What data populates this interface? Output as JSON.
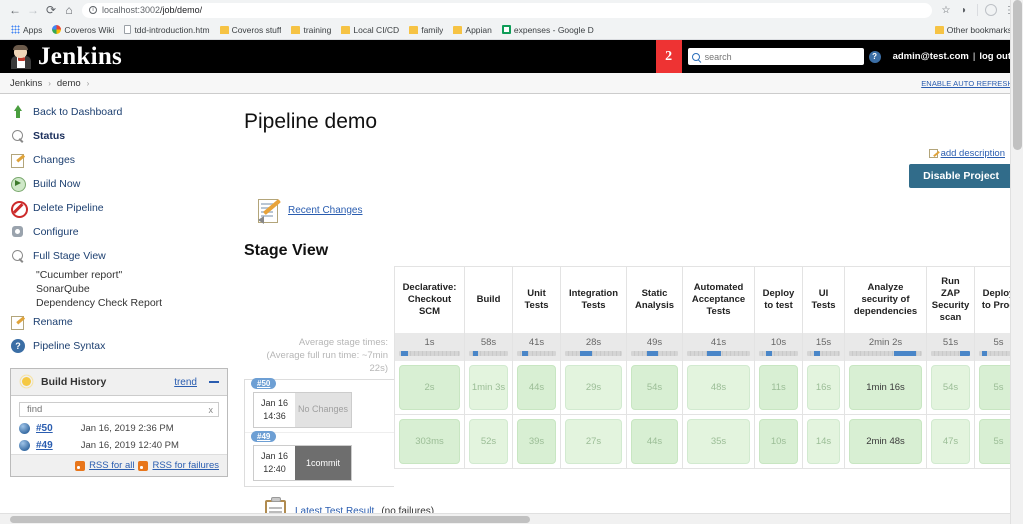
{
  "browser": {
    "nav": {
      "back": "←",
      "forward": "→",
      "reload": "⟳",
      "home": "⌂"
    },
    "url_host": "localhost:3002",
    "url_path": "/job/demo/",
    "star_icon": "☆",
    "moon_icon": "◗",
    "menu_icon": "⋮",
    "bookmarks": [
      {
        "label": "Apps",
        "icon": "apps-icon"
      },
      {
        "label": "Coveros Wiki",
        "icon": "google-icon"
      },
      {
        "label": "tdd-introduction.htm",
        "icon": "document-icon"
      },
      {
        "label": "Coveros stuff",
        "icon": "folder-icon"
      },
      {
        "label": "training",
        "icon": "folder-icon"
      },
      {
        "label": "Local CI/CD",
        "icon": "folder-icon"
      },
      {
        "label": "family",
        "icon": "folder-icon"
      },
      {
        "label": "Appian",
        "icon": "folder-icon"
      },
      {
        "label": "expenses - Google D",
        "icon": "sheets-icon"
      }
    ],
    "other_bookmarks": "Other bookmarks"
  },
  "header": {
    "title": "Jenkins",
    "queue_count": "2",
    "search_placeholder": "search",
    "help_icon": "?",
    "user": "admin@test.com",
    "separator": "|",
    "logout": "log out"
  },
  "breadcrumb": {
    "items": [
      "Jenkins",
      "demo"
    ],
    "arrow": "›",
    "auto_refresh": "ENABLE AUTO REFRESH"
  },
  "sidebar": {
    "items": [
      {
        "label": "Back to Dashboard",
        "icon": "up-arrow-icon",
        "bold": false
      },
      {
        "label": "Status",
        "icon": "magnifier-icon",
        "bold": true
      },
      {
        "label": "Changes",
        "icon": "edit-icon",
        "bold": false
      },
      {
        "label": "Build Now",
        "icon": "play-icon",
        "bold": false
      },
      {
        "label": "Delete Pipeline",
        "icon": "deny-icon",
        "bold": false
      },
      {
        "label": "Configure",
        "icon": "gear-icon",
        "bold": false
      },
      {
        "label": "Full Stage View",
        "icon": "magnifier-icon",
        "bold": false
      }
    ],
    "sub_items": [
      "\"Cucumber report\"",
      "SonarQube",
      "Dependency Check Report"
    ],
    "items_after": [
      {
        "label": "Rename",
        "icon": "edit-icon",
        "bold": false
      },
      {
        "label": "Pipeline Syntax",
        "icon": "help-icon",
        "bold": false
      }
    ]
  },
  "build_history": {
    "title": "Build History",
    "trend_label": "trend",
    "find_placeholder": "find",
    "find_clear": "x",
    "builds": [
      {
        "number": "#50",
        "date": "Jan 16, 2019 2:36 PM"
      },
      {
        "number": "#49",
        "date": "Jan 16, 2019 12:40 PM"
      }
    ],
    "rss_all": "RSS for all",
    "rss_failures": "RSS for failures"
  },
  "main": {
    "page_title": "Pipeline demo",
    "add_description": "add description",
    "disable_button": "Disable Project",
    "recent_changes": "Recent Changes",
    "stage_view_heading": "Stage View",
    "avg_note_line1": "Average stage times:",
    "avg_note_line2": "(Average full run time: ~7min",
    "avg_note_line3": "22s)",
    "latest_test_result_link": "Latest Test Result",
    "latest_test_result_note": "(no failures)"
  },
  "chart_data": {
    "type": "table",
    "title": "Stage View",
    "categories": [
      "Declarative: Checkout SCM",
      "Build",
      "Unit Tests",
      "Integration Tests",
      "Static Analysis",
      "Automated Acceptance Tests",
      "Deploy to test",
      "UI Tests",
      "Analyze security of dependencies",
      "Run ZAP Security scan",
      "Deploy to Prod"
    ],
    "average_times": [
      "1s",
      "58s",
      "41s",
      "28s",
      "49s",
      "41s",
      "10s",
      "15s",
      "2min 2s",
      "51s",
      "5s"
    ],
    "average_bar_pct": [
      4,
      10,
      14,
      26,
      33,
      31,
      17,
      20,
      62,
      75,
      8
    ],
    "runs": [
      {
        "build": "#50",
        "date_day": "Jan 16",
        "date_time": "14:36",
        "changes": "No Changes",
        "changes_type": "none",
        "values": [
          "2s",
          "1min 3s",
          "44s",
          "29s",
          "54s",
          "48s",
          "11s",
          "16s",
          "1min 16s",
          "54s",
          "5s"
        ]
      },
      {
        "build": "#49",
        "date_day": "Jan 16",
        "date_time": "12:40",
        "changes_count": "1",
        "changes_unit": "commit",
        "changes_type": "has",
        "values": [
          "303ms",
          "52s",
          "39s",
          "27s",
          "44s",
          "35s",
          "10s",
          "14s",
          "2min 48s",
          "47s",
          "5s"
        ]
      }
    ],
    "cell_color_success": "#d8efd3",
    "cell_color_success_alt": "#e3f4de",
    "accent_blue": "#4a86c8",
    "badge_blue": "#6d9fd4"
  }
}
